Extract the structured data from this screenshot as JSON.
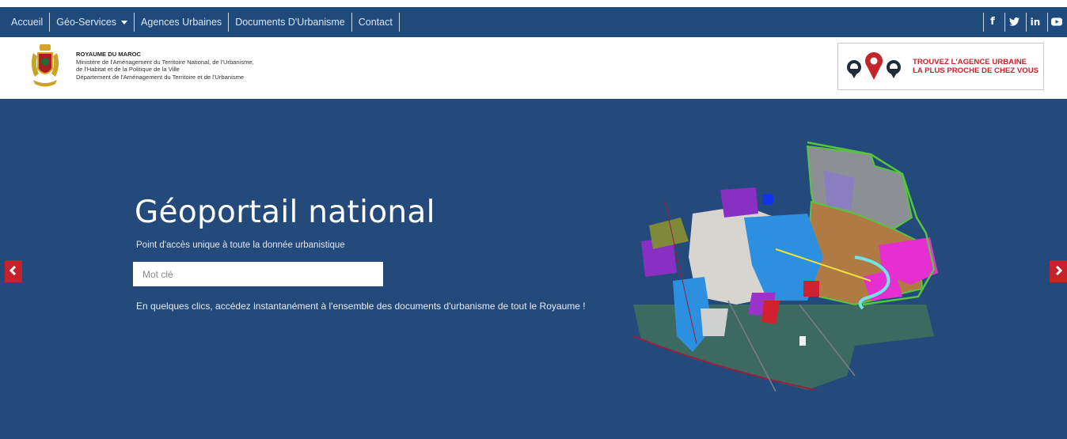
{
  "nav": {
    "items": [
      {
        "label": "Accueil"
      },
      {
        "label": "Géo-Services",
        "has_dropdown": true
      },
      {
        "label": "Agences Urbaines"
      },
      {
        "label": "Documents D'Urbanisme"
      },
      {
        "label": "Contact"
      }
    ],
    "social": [
      {
        "icon": "facebook-icon",
        "glyph": "f"
      },
      {
        "icon": "twitter-icon"
      },
      {
        "icon": "linkedin-icon",
        "glyph": "in"
      },
      {
        "icon": "youtube-icon"
      }
    ],
    "bg_color": "#1f4a7c"
  },
  "header": {
    "line1": "ROYAUME DU MAROC",
    "line2": "Ministère de l'Aménagement du Territoire National, de l'Urbanisme,",
    "line3": "de l'Habitat et de la Politique de la Ville",
    "line4": "Département de l'Aménagement du Territoire et de l'Urbanisme",
    "emblem_icon": "coat-of-arms-icon"
  },
  "promo": {
    "line1": "TROUVEZ L'AGENCE URBAINE",
    "line2": "LA PLUS PROCHE DE CHEZ VOUS",
    "icon": "map-pins-icon",
    "color": "#c4232b"
  },
  "hero": {
    "title": "Géoportail national",
    "subtitle": "Point d'accès unique à toute la donnée urbanistique",
    "search_placeholder": "Mot clé",
    "description": "En quelques clics, accédez instantanément à l'ensemble des documents d'urbanisme de tout le Royaume !",
    "bg_color": "#234a7a",
    "prev_icon": "chevron-left-icon",
    "next_icon": "chevron-right-icon"
  }
}
